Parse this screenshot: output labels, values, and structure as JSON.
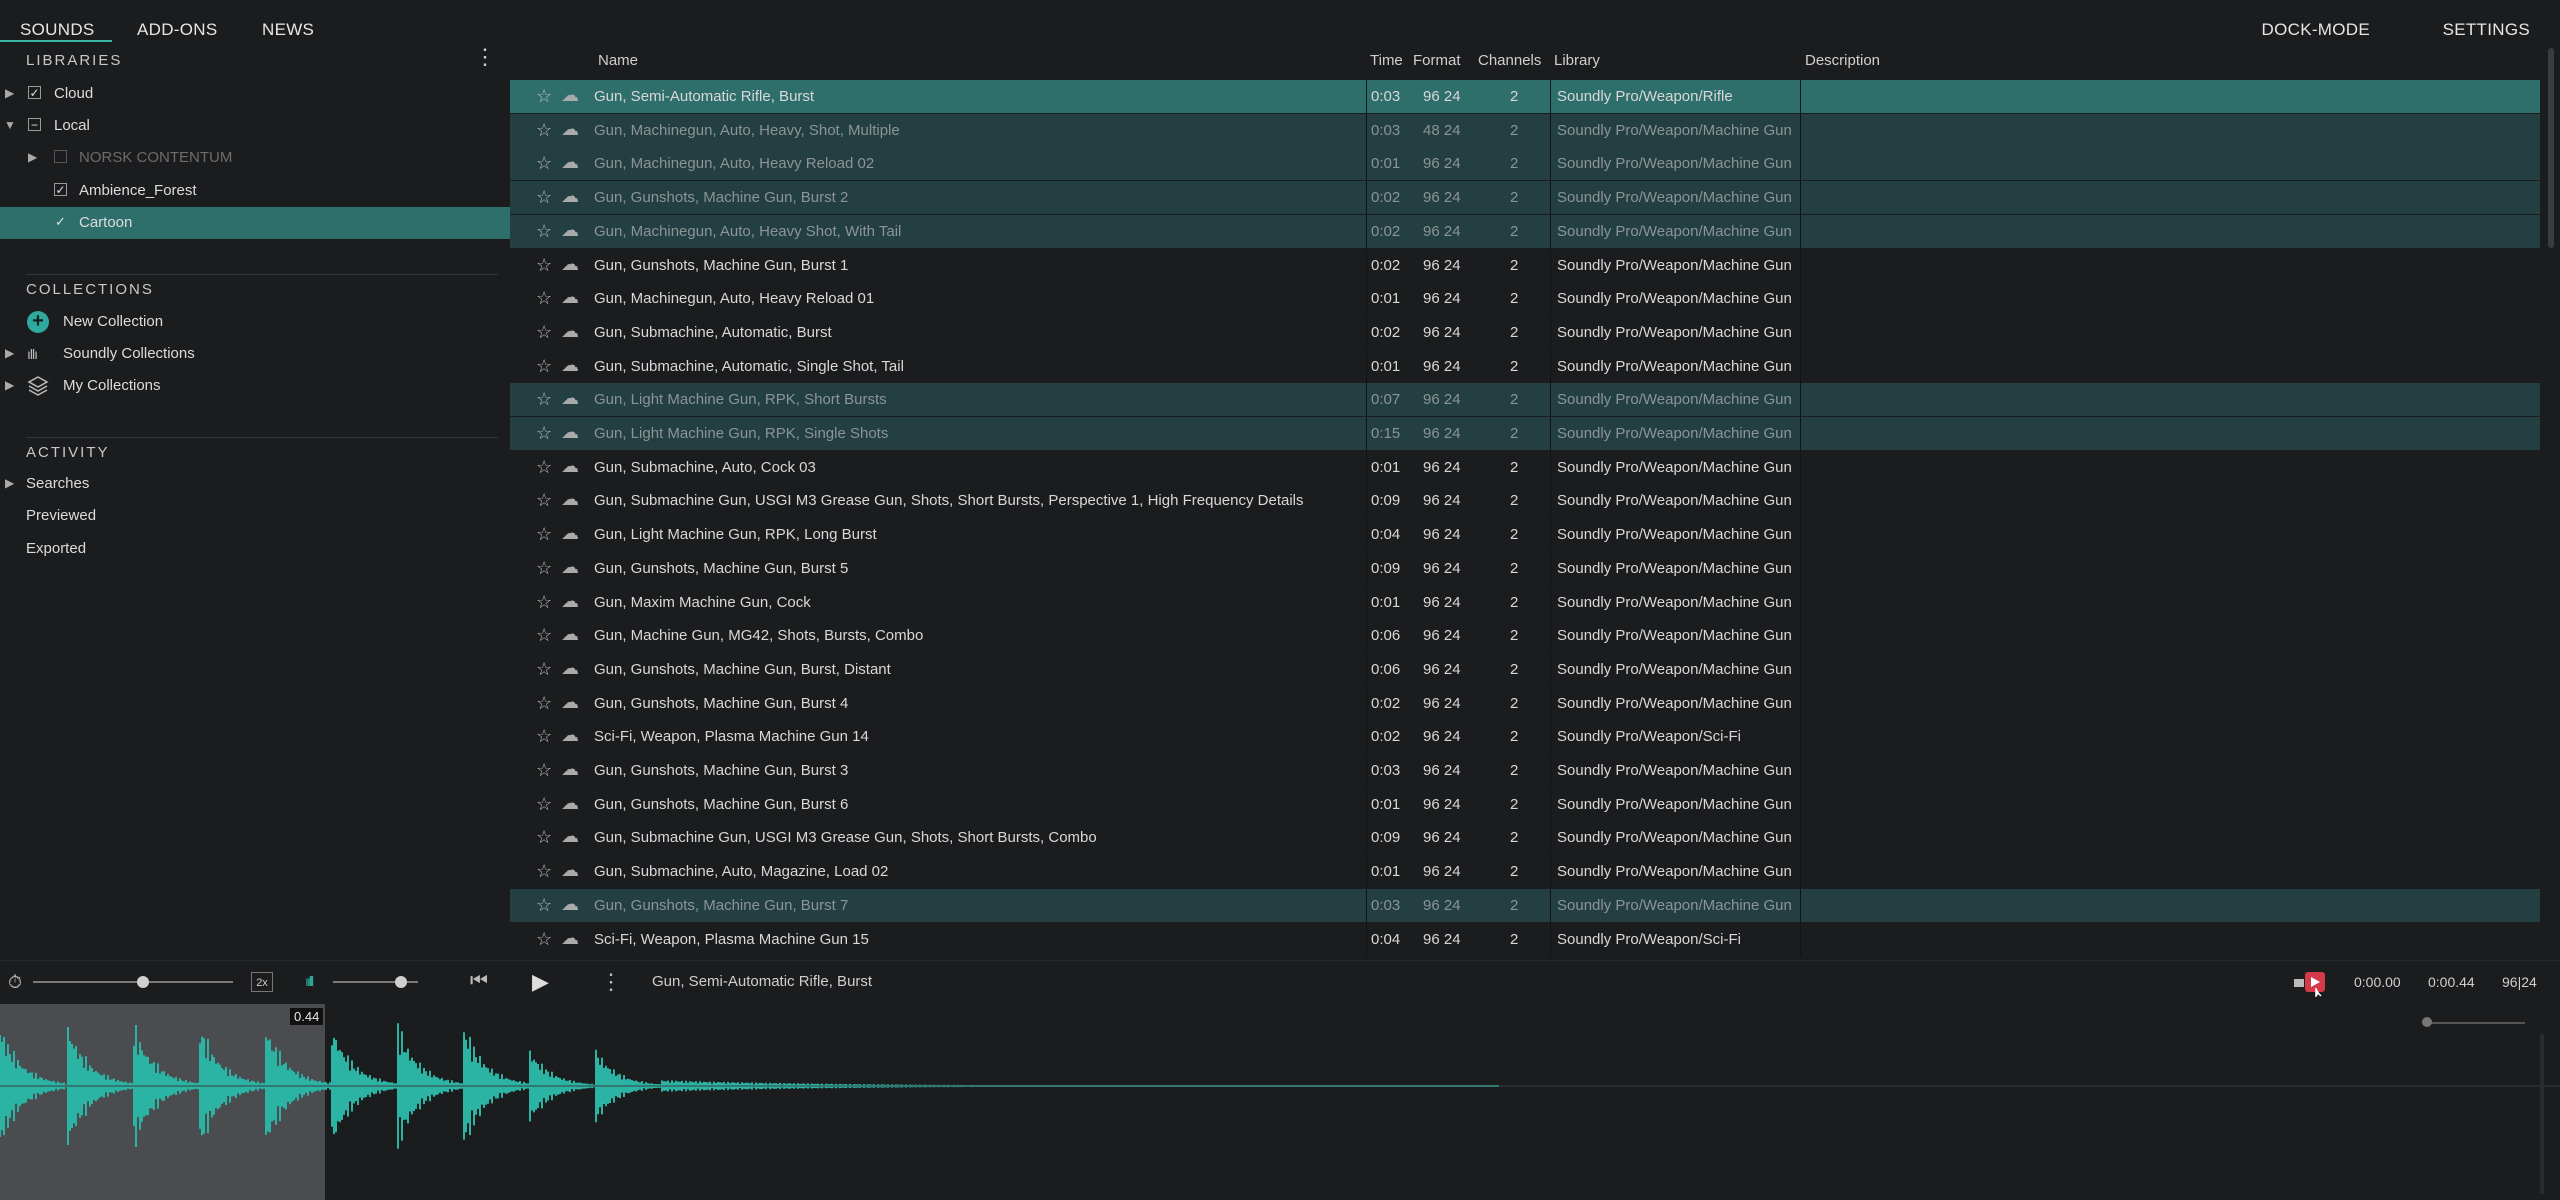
{
  "nav": {
    "tabs": [
      "SOUNDS",
      "ADD-ONS",
      "NEWS"
    ],
    "dock_mode": "DOCK-MODE",
    "settings": "SETTINGS"
  },
  "sidebar": {
    "libraries_title": "LIBRARIES",
    "libraries": [
      {
        "label": "Cloud",
        "expanded": false,
        "checked": "check"
      },
      {
        "label": "Local",
        "expanded": true,
        "checked": "partial"
      },
      {
        "label": "NORSK CONTENTUM",
        "checked": "none",
        "disabled": true
      },
      {
        "label": "Ambience_Forest",
        "checked": "check"
      },
      {
        "label": "Cartoon",
        "checked": "check",
        "selected": true
      }
    ],
    "collections_title": "COLLECTIONS",
    "collections": [
      {
        "label": "New Collection",
        "icon": "plus-circle-icon"
      },
      {
        "label": "Soundly Collections",
        "icon": "waveform-icon"
      },
      {
        "label": "My Collections",
        "icon": "layers-icon"
      }
    ],
    "activity_title": "ACTIVITY",
    "activity": [
      "Searches",
      "Previewed",
      "Exported"
    ]
  },
  "table": {
    "headers": {
      "name": "Name",
      "time": "Time",
      "format": "Format",
      "channels": "Channels",
      "library": "Library",
      "description": "Description"
    },
    "rows": [
      {
        "name": "Gun, Semi-Automatic Rifle, Burst",
        "time": "0:03",
        "format": "96 24",
        "channels": "2",
        "library": "Soundly Pro/Weapon/Rifle",
        "state": "sel"
      },
      {
        "name": "Gun, Machinegun, Auto, Heavy, Shot, Multiple",
        "time": "0:03",
        "format": "48 24",
        "channels": "2",
        "library": "Soundly Pro/Weapon/Machine Gun",
        "state": "hl"
      },
      {
        "name": "Gun, Machinegun, Auto, Heavy Reload 02",
        "time": "0:01",
        "format": "96 24",
        "channels": "2",
        "library": "Soundly Pro/Weapon/Machine Gun",
        "state": "hl"
      },
      {
        "name": "Gun, Gunshots, Machine Gun, Burst 2",
        "time": "0:02",
        "format": "96 24",
        "channels": "2",
        "library": "Soundly Pro/Weapon/Machine Gun",
        "state": "hl"
      },
      {
        "name": "Gun, Machinegun, Auto, Heavy Shot, With Tail",
        "time": "0:02",
        "format": "96 24",
        "channels": "2",
        "library": "Soundly Pro/Weapon/Machine Gun",
        "state": "hl"
      },
      {
        "name": "Gun, Gunshots, Machine Gun, Burst 1",
        "time": "0:02",
        "format": "96 24",
        "channels": "2",
        "library": "Soundly Pro/Weapon/Machine Gun",
        "state": ""
      },
      {
        "name": "Gun, Machinegun, Auto, Heavy Reload 01",
        "time": "0:01",
        "format": "96 24",
        "channels": "2",
        "library": "Soundly Pro/Weapon/Machine Gun",
        "state": ""
      },
      {
        "name": "Gun, Submachine, Automatic, Burst",
        "time": "0:02",
        "format": "96 24",
        "channels": "2",
        "library": "Soundly Pro/Weapon/Machine Gun",
        "state": ""
      },
      {
        "name": "Gun, Submachine, Automatic, Single Shot, Tail",
        "time": "0:01",
        "format": "96 24",
        "channels": "2",
        "library": "Soundly Pro/Weapon/Machine Gun",
        "state": ""
      },
      {
        "name": "Gun, Light Machine Gun, RPK, Short Bursts",
        "time": "0:07",
        "format": "96 24",
        "channels": "2",
        "library": "Soundly Pro/Weapon/Machine Gun",
        "state": "hl"
      },
      {
        "name": "Gun, Light Machine Gun, RPK, Single Shots",
        "time": "0:15",
        "format": "96 24",
        "channels": "2",
        "library": "Soundly Pro/Weapon/Machine Gun",
        "state": "hl"
      },
      {
        "name": "Gun, Submachine, Auto, Cock 03",
        "time": "0:01",
        "format": "96 24",
        "channels": "2",
        "library": "Soundly Pro/Weapon/Machine Gun",
        "state": ""
      },
      {
        "name": "Gun, Submachine Gun, USGI M3 Grease Gun, Shots, Short Bursts, Perspective 1, High Frequency Details",
        "time": "0:09",
        "format": "96 24",
        "channels": "2",
        "library": "Soundly Pro/Weapon/Machine Gun",
        "state": ""
      },
      {
        "name": "Gun, Light Machine Gun, RPK, Long Burst",
        "time": "0:04",
        "format": "96 24",
        "channels": "2",
        "library": "Soundly Pro/Weapon/Machine Gun",
        "state": ""
      },
      {
        "name": "Gun, Gunshots, Machine Gun, Burst 5",
        "time": "0:09",
        "format": "96 24",
        "channels": "2",
        "library": "Soundly Pro/Weapon/Machine Gun",
        "state": ""
      },
      {
        "name": "Gun, Maxim Machine Gun, Cock",
        "time": "0:01",
        "format": "96 24",
        "channels": "2",
        "library": "Soundly Pro/Weapon/Machine Gun",
        "state": ""
      },
      {
        "name": "Gun, Machine Gun, MG42, Shots, Bursts, Combo",
        "time": "0:06",
        "format": "96 24",
        "channels": "2",
        "library": "Soundly Pro/Weapon/Machine Gun",
        "state": ""
      },
      {
        "name": "Gun, Gunshots, Machine Gun, Burst, Distant",
        "time": "0:06",
        "format": "96 24",
        "channels": "2",
        "library": "Soundly Pro/Weapon/Machine Gun",
        "state": ""
      },
      {
        "name": "Gun, Gunshots, Machine Gun, Burst 4",
        "time": "0:02",
        "format": "96 24",
        "channels": "2",
        "library": "Soundly Pro/Weapon/Machine Gun",
        "state": ""
      },
      {
        "name": "Sci-Fi, Weapon, Plasma Machine Gun 14",
        "time": "0:02",
        "format": "96 24",
        "channels": "2",
        "library": "Soundly Pro/Weapon/Sci-Fi",
        "state": ""
      },
      {
        "name": "Gun, Gunshots, Machine Gun, Burst 3",
        "time": "0:03",
        "format": "96 24",
        "channels": "2",
        "library": "Soundly Pro/Weapon/Machine Gun",
        "state": ""
      },
      {
        "name": "Gun, Gunshots, Machine Gun, Burst 6",
        "time": "0:01",
        "format": "96 24",
        "channels": "2",
        "library": "Soundly Pro/Weapon/Machine Gun",
        "state": ""
      },
      {
        "name": "Gun, Submachine Gun, USGI M3 Grease Gun, Shots, Short Bursts, Combo",
        "time": "0:09",
        "format": "96 24",
        "channels": "2",
        "library": "Soundly Pro/Weapon/Machine Gun",
        "state": ""
      },
      {
        "name": "Gun, Submachine, Auto, Magazine, Load 02",
        "time": "0:01",
        "format": "96 24",
        "channels": "2",
        "library": "Soundly Pro/Weapon/Machine Gun",
        "state": ""
      },
      {
        "name": "Gun, Gunshots, Machine Gun, Burst 7",
        "time": "0:03",
        "format": "96 24",
        "channels": "2",
        "library": "Soundly Pro/Weapon/Machine Gun",
        "state": "hl"
      },
      {
        "name": "Sci-Fi, Weapon, Plasma Machine Gun 15",
        "time": "0:04",
        "format": "96 24",
        "channels": "2",
        "library": "Soundly Pro/Weapon/Sci-Fi",
        "state": ""
      }
    ]
  },
  "player": {
    "speed_label": "2x",
    "now_playing": "Gun, Semi-Automatic Rifle, Burst",
    "time_current": "0:00.00",
    "time_total": "0:00.44",
    "format": "96|24",
    "cursor_label": "0.44",
    "pitch_level": 0.55,
    "volume_level": 0.8
  },
  "colors": {
    "accent": "#36b5a8",
    "selected_row": "#2e6f6b",
    "highlight_row": "#233f41",
    "waveform": "#2bb3a3"
  }
}
